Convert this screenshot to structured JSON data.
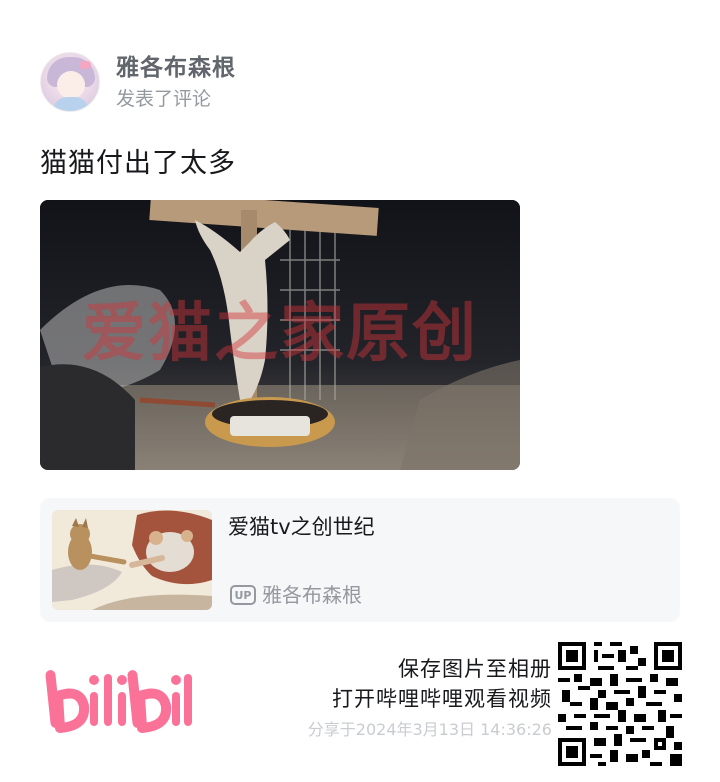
{
  "author": {
    "name": "雅各布森根",
    "action": "发表了评论"
  },
  "comment": {
    "text": "猫猫付出了太多"
  },
  "photo": {
    "watermark": "爱猫之家原创"
  },
  "video": {
    "title": "爱猫tv之创世纪",
    "up_badge": "UP",
    "up_name": "雅各布森根"
  },
  "footer": {
    "logo_text": "bilibili",
    "line1": "保存图片至相册",
    "line2": "打开哔哩哔哩观看视频",
    "share_time": "分享于2024年3月13日 14:36:26"
  },
  "colors": {
    "brand_pink": "#fb7299",
    "text_primary": "#18191c",
    "text_secondary": "#9499a0",
    "card_bg": "#f6f7f8"
  }
}
